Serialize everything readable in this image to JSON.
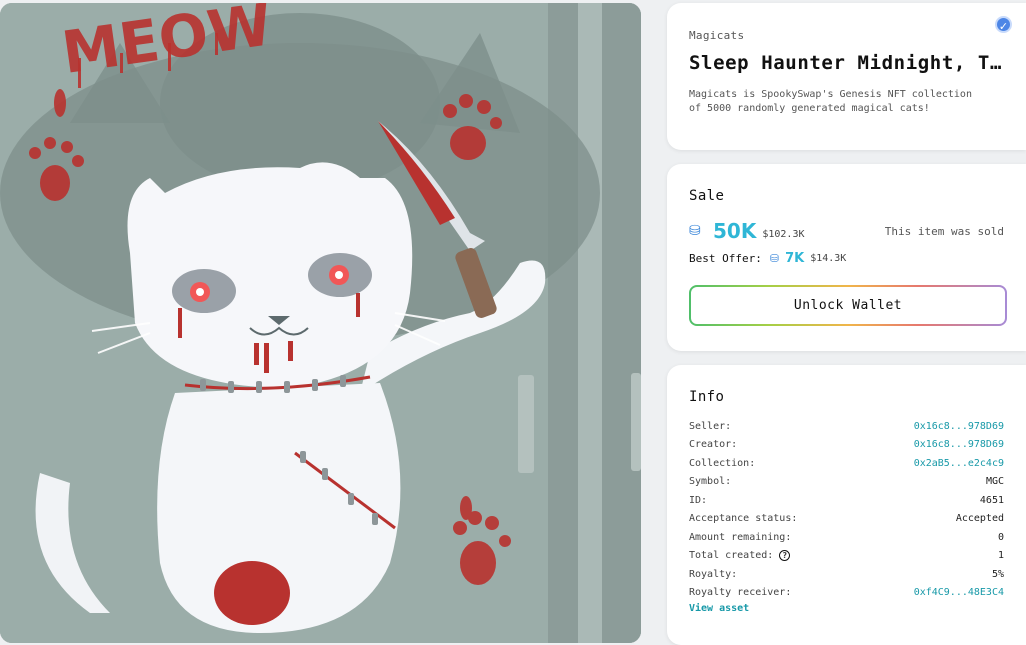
{
  "artwork": {
    "alt": "Sleep Haunter Midnight artwork",
    "wall_text": "MEOW"
  },
  "header": {
    "collection": "Magicats",
    "title": "Sleep Haunter Midnight, The Cursed",
    "description": "Magicats is SpookySwap's Genesis NFT collection of 5000 randomly generated magical cats!",
    "verified_icon": "check-circle-icon"
  },
  "sale": {
    "title": "Sale",
    "currency_icon": "fantom-icon",
    "price": "50K",
    "price_usd": "$102.3K",
    "status": "This item was sold",
    "best_offer_label": "Best Offer:",
    "best_offer_price": "7K",
    "best_offer_usd": "$14.3K",
    "unlock_label": "Unlock Wallet"
  },
  "info": {
    "title": "Info",
    "rows": [
      {
        "label": "Seller:",
        "value": "0x16c8...978D69",
        "link": true
      },
      {
        "label": "Creator:",
        "value": "0x16c8...978D69",
        "link": true
      },
      {
        "label": "Collection:",
        "value": "0x2aB5...e2c4c9",
        "link": true
      },
      {
        "label": "Symbol:",
        "value": "MGC",
        "link": false
      },
      {
        "label": "ID:",
        "value": "4651",
        "link": false
      },
      {
        "label": "Acceptance status:",
        "value": "Accepted",
        "link": false
      },
      {
        "label": "Amount remaining:",
        "value": "0",
        "link": false
      },
      {
        "label": "Total created:",
        "value": "1",
        "link": false,
        "help": true
      },
      {
        "label": "Royalty:",
        "value": "5%",
        "link": false
      },
      {
        "label": "Royalty receiver:",
        "value": "0xf4C9...48E3C4",
        "link": true
      }
    ],
    "view_asset": "View asset"
  },
  "colors": {
    "accent": "#2fb6d6",
    "link": "#1899a8",
    "verified": "#4d86e6"
  }
}
